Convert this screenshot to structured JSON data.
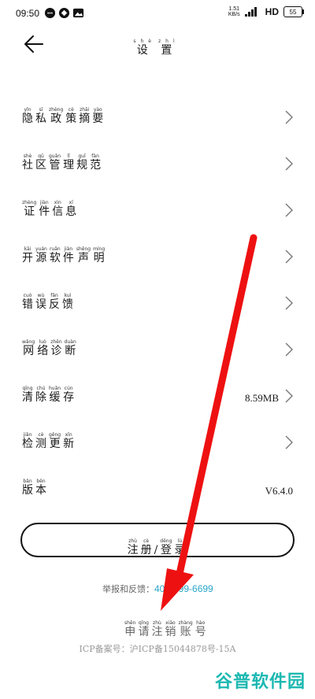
{
  "status_bar": {
    "time": "09:50",
    "speed_top": "1.51",
    "speed_bottom": "KB/s",
    "network": "HD",
    "battery": "55"
  },
  "header": {
    "title_chars": [
      [
        "shè",
        "设"
      ],
      [
        "zhì",
        "置"
      ]
    ]
  },
  "menu": [
    {
      "chars": [
        [
          "yǐn",
          "隐"
        ],
        [
          "sī",
          "私"
        ],
        [
          "zhèng",
          "政"
        ],
        [
          "cè",
          "策"
        ],
        [
          "zhāi",
          "摘"
        ],
        [
          "yào",
          "要"
        ]
      ],
      "value": "",
      "chevron": true
    },
    {
      "chars": [
        [
          "shè",
          "社"
        ],
        [
          "qū",
          "区"
        ],
        [
          "guǎn",
          "管"
        ],
        [
          "lǐ",
          "理"
        ],
        [
          "guī",
          "规"
        ],
        [
          "fàn",
          "范"
        ]
      ],
      "value": "",
      "chevron": true
    },
    {
      "chars": [
        [
          "zhèng",
          "证"
        ],
        [
          "jiàn",
          "件"
        ],
        [
          "xìn",
          "信"
        ],
        [
          "xī",
          "息"
        ]
      ],
      "value": "",
      "chevron": true
    },
    {
      "chars": [
        [
          "kāi",
          "开"
        ],
        [
          "yuán",
          "源"
        ],
        [
          "ruǎn",
          "软"
        ],
        [
          "jiàn",
          "件"
        ],
        [
          "shēng",
          "声"
        ],
        [
          "míng",
          "明"
        ]
      ],
      "value": "",
      "chevron": true
    },
    {
      "chars": [
        [
          "cuò",
          "错"
        ],
        [
          "wù",
          "误"
        ],
        [
          "fǎn",
          "反"
        ],
        [
          "kuì",
          "馈"
        ]
      ],
      "value": "",
      "chevron": true
    },
    {
      "chars": [
        [
          "wǎng",
          "网"
        ],
        [
          "luò",
          "络"
        ],
        [
          "zhěn",
          "诊"
        ],
        [
          "duàn",
          "断"
        ]
      ],
      "value": "",
      "chevron": true
    },
    {
      "chars": [
        [
          "qīng",
          "清"
        ],
        [
          "chú",
          "除"
        ],
        [
          "huǎn",
          "缓"
        ],
        [
          "cún",
          "存"
        ]
      ],
      "value": "8.59MB",
      "chevron": true
    },
    {
      "chars": [
        [
          "jiǎn",
          "检"
        ],
        [
          "cè",
          "测"
        ],
        [
          "gēng",
          "更"
        ],
        [
          "xīn",
          "新"
        ]
      ],
      "value": "",
      "chevron": true
    },
    {
      "chars": [
        [
          "bǎn",
          "版"
        ],
        [
          "běn",
          "本"
        ]
      ],
      "value": "V6.4.0",
      "chevron": false
    }
  ],
  "register_button": {
    "chars": [
      [
        "zhù",
        "注"
      ],
      [
        "cè",
        "册"
      ],
      [
        "",
        "/"
      ],
      [
        "dēng",
        "登"
      ],
      [
        "lù",
        "录"
      ]
    ]
  },
  "report_line": {
    "label": "举报和反馈：",
    "phone": "400-999-6699"
  },
  "deregister": {
    "chars": [
      [
        "shēn",
        "申"
      ],
      [
        "qǐng",
        "请"
      ],
      [
        "zhù",
        "注"
      ],
      [
        "xiāo",
        "销"
      ],
      [
        "zhàng",
        "账"
      ],
      [
        "hào",
        "号"
      ]
    ]
  },
  "icp": "ICP备案号：沪ICP备15044878号-15A",
  "watermark": "谷普软件园",
  "colors": {
    "arrow": "#ee1111",
    "link": "#2aa6c9",
    "watermark": "#1cb8b1"
  }
}
